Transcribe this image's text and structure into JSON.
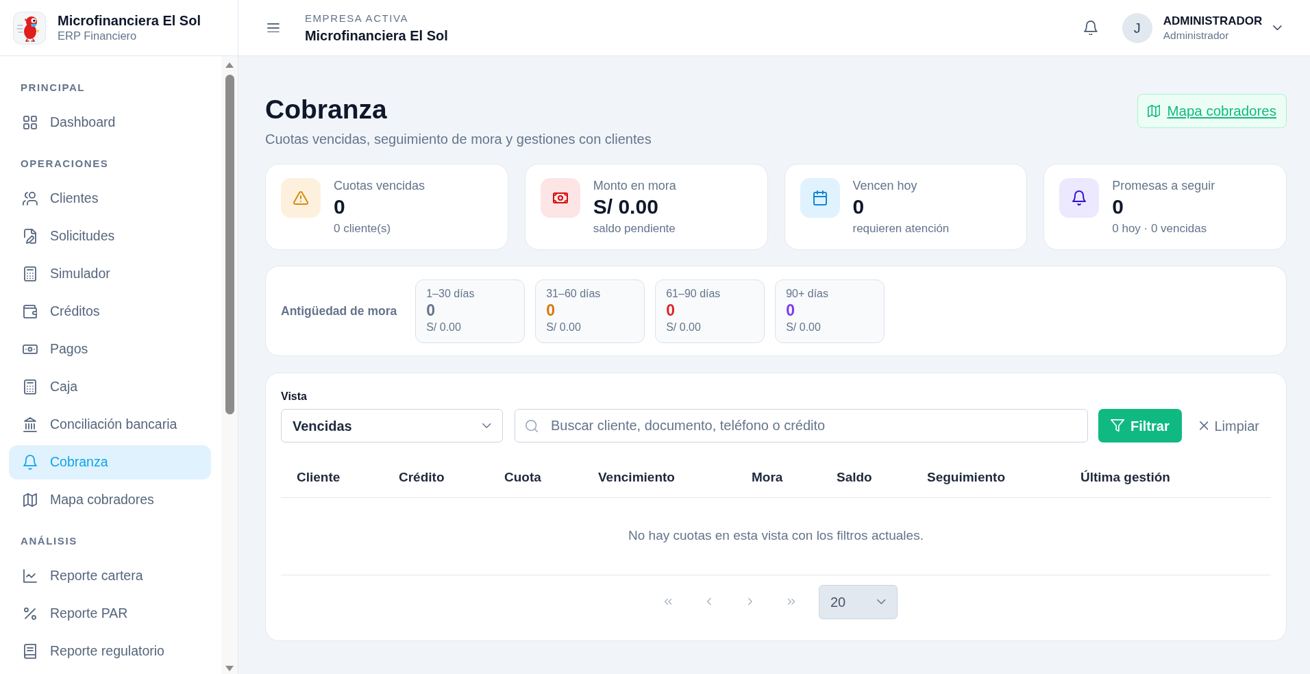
{
  "sidebar": {
    "brand": {
      "title": "Microfinanciera El Sol",
      "subtitle": "ERP Financiero"
    },
    "sections": [
      {
        "title": "PRINCIPAL",
        "items": [
          {
            "label": "Dashboard",
            "selected": false
          }
        ]
      },
      {
        "title": "OPERACIONES",
        "items": [
          {
            "label": "Clientes",
            "selected": false
          },
          {
            "label": "Solicitudes",
            "selected": false
          },
          {
            "label": "Simulador",
            "selected": false
          },
          {
            "label": "Créditos",
            "selected": false
          },
          {
            "label": "Pagos",
            "selected": false
          },
          {
            "label": "Caja",
            "selected": false
          },
          {
            "label": "Conciliación bancaria",
            "selected": false
          },
          {
            "label": "Cobranza",
            "selected": true
          },
          {
            "label": "Mapa cobradores",
            "selected": false
          }
        ]
      },
      {
        "title": "ANÁLISIS",
        "items": [
          {
            "label": "Reporte cartera",
            "selected": false
          },
          {
            "label": "Reporte PAR",
            "selected": false
          },
          {
            "label": "Reporte regulatorio",
            "selected": false
          }
        ]
      }
    ]
  },
  "header": {
    "company_label": "EMPRESA ACTIVA",
    "company_name": "Microfinanciera El Sol",
    "user": {
      "initial": "J",
      "name": "ADMINISTRADOR",
      "role": "Administrador"
    }
  },
  "page": {
    "title": "Cobranza",
    "subtitle": "Cuotas vencidas, seguimiento de mora y gestiones con clientes",
    "action": "Mapa cobradores"
  },
  "stats": [
    {
      "label": "Cuotas vencidas",
      "value": "0",
      "note": "0 cliente(s)",
      "color": "#fdf1de"
    },
    {
      "label": "Monto en mora",
      "value": "S/ 0.00",
      "note": "saldo pendiente",
      "color": "#fde5e5"
    },
    {
      "label": "Vencen hoy",
      "value": "0",
      "note": "requieren atención",
      "color": "#e0f2fe"
    },
    {
      "label": "Promesas a seguir",
      "value": "0",
      "note": "0 hoy · 0 vencidas",
      "color": "#ece9fe"
    }
  ],
  "aging": {
    "title": "Antigüedad de mora",
    "buckets": [
      {
        "label": "1–30 días",
        "count": "0",
        "amount": "S/ 0.00",
        "color": "#64748b"
      },
      {
        "label": "31–60 días",
        "count": "0",
        "amount": "S/ 0.00",
        "color": "#d97706"
      },
      {
        "label": "61–90 días",
        "count": "0",
        "amount": "S/ 0.00",
        "color": "#dc2626"
      },
      {
        "label": "90+ días",
        "count": "0",
        "amount": "S/ 0.00",
        "color": "#7c3aed"
      }
    ]
  },
  "collections": {
    "filters": {
      "view_label": "Vista",
      "view_value": "Vencidas",
      "search_placeholder": "Buscar cliente, documento, teléfono o crédito",
      "filter_button": "Filtrar",
      "clear_button": "Limpiar"
    },
    "table": {
      "columns": [
        "Cliente",
        "Crédito",
        "Cuota",
        "Vencimiento",
        "Mora",
        "Saldo",
        "Seguimiento",
        "Última gestión"
      ],
      "empty_message": "No hay cuotas en esta vista con los filtros actuales."
    },
    "pagination": {
      "buttons": [
        {
          "disabled": true
        },
        {
          "disabled": true
        },
        {
          "disabled": true
        },
        {
          "disabled": true
        }
      ],
      "page_size": "20"
    }
  }
}
